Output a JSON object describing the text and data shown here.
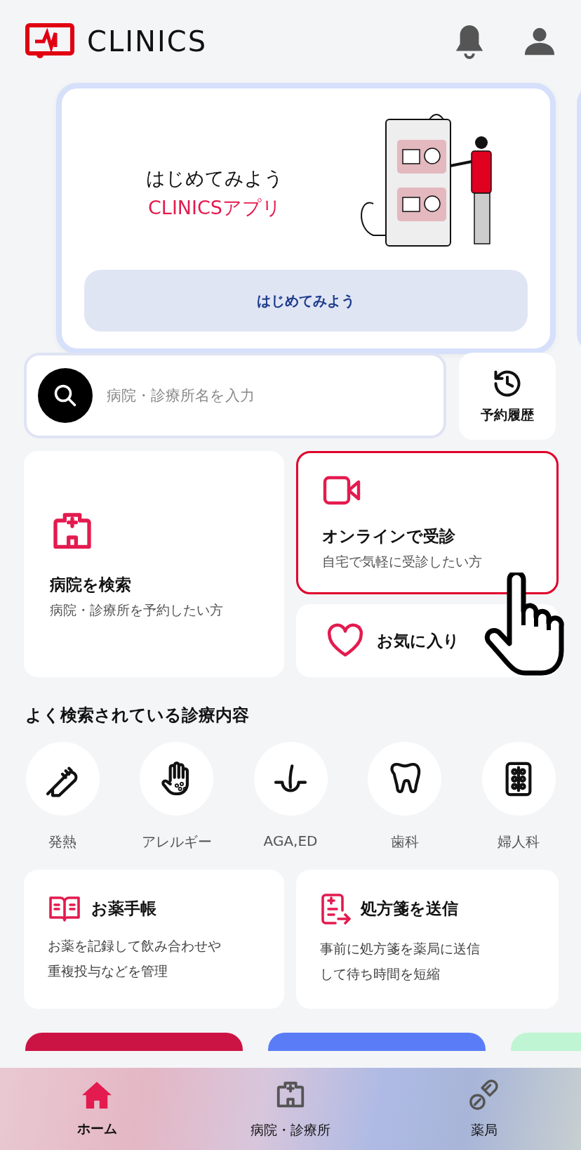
{
  "header": {
    "logo": "CLINICS"
  },
  "banner": {
    "title": "はじめてみよう",
    "subtitle": "CLINICSアプリ",
    "button": "はじめてみよう"
  },
  "search": {
    "placeholder": "病院・診療所名を入力"
  },
  "history_button": {
    "label": "予約履歴"
  },
  "menu_cards": [
    {
      "kind": "hospital",
      "title": "病院を検索",
      "subtitle": "病院・診療所を予約したい方",
      "selected": false
    },
    {
      "kind": "online",
      "title": "オンラインで受診",
      "subtitle": "自宅で気軽に受診したい方",
      "selected": true
    },
    {
      "kind": "favorite",
      "title": "お気に入り",
      "selected": false
    }
  ],
  "popular": {
    "title": "よく検索されている診療内容",
    "items": [
      {
        "kind": "fever",
        "label": "発熱"
      },
      {
        "kind": "allergy",
        "label": "アレルギー"
      },
      {
        "kind": "aga",
        "label": "AGA,ED"
      },
      {
        "kind": "dental",
        "label": "歯科"
      },
      {
        "kind": "gyne",
        "label": "婦人科"
      }
    ]
  },
  "tools": [
    {
      "kind": "notebook",
      "title": "お薬手帳",
      "description": [
        "お薬を記録して飲み合わせや",
        "重複投与などを管理"
      ]
    },
    {
      "kind": "prescription",
      "title": "処方箋を送信",
      "description": [
        "事前に処方箋を薬局に送信",
        "して待ち時間を短縮"
      ]
    }
  ],
  "promos": [
    {
      "color": "#cc1444"
    },
    {
      "color": "#5a7cf6"
    },
    {
      "color": "#bff5d2"
    }
  ],
  "nav": [
    {
      "kind": "home",
      "label": "ホーム",
      "selected": true
    },
    {
      "kind": "hospital",
      "label": "病院・診療所",
      "selected": false
    },
    {
      "kind": "pharmacy",
      "label": "薬局",
      "selected": false
    }
  ]
}
